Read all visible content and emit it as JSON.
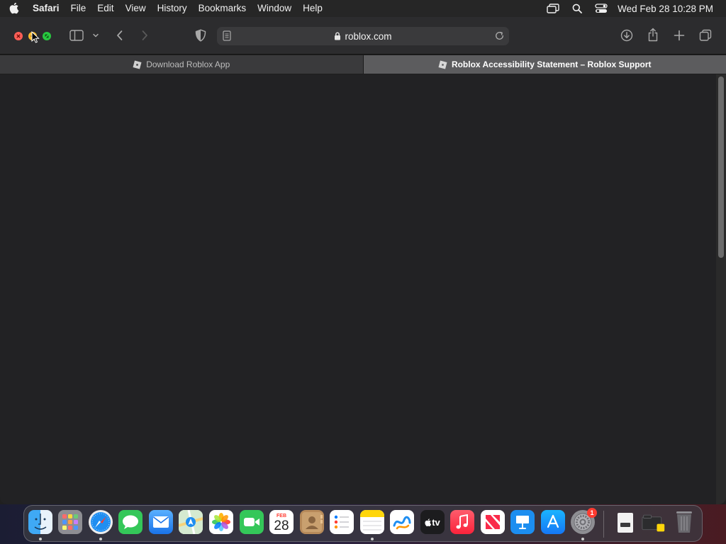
{
  "menubar": {
    "app_name": "Safari",
    "items": [
      "File",
      "Edit",
      "View",
      "History",
      "Bookmarks",
      "Window",
      "Help"
    ],
    "clock": "Wed Feb 28  10:28 PM"
  },
  "browser": {
    "url": "roblox.com",
    "tabs": [
      {
        "title": "Download Roblox App",
        "active": false
      },
      {
        "title": "Roblox Accessibility Statement – Roblox Support",
        "active": true
      }
    ],
    "scroll_position": 0.0
  },
  "dock": {
    "calendar_month": "FEB",
    "calendar_day": "28",
    "tv_label": "tv",
    "settings_badge": "1"
  },
  "colors": {
    "close": "#ff5f57",
    "minimize": "#febc2e",
    "zoom": "#28c840",
    "page_background": "#222224"
  }
}
